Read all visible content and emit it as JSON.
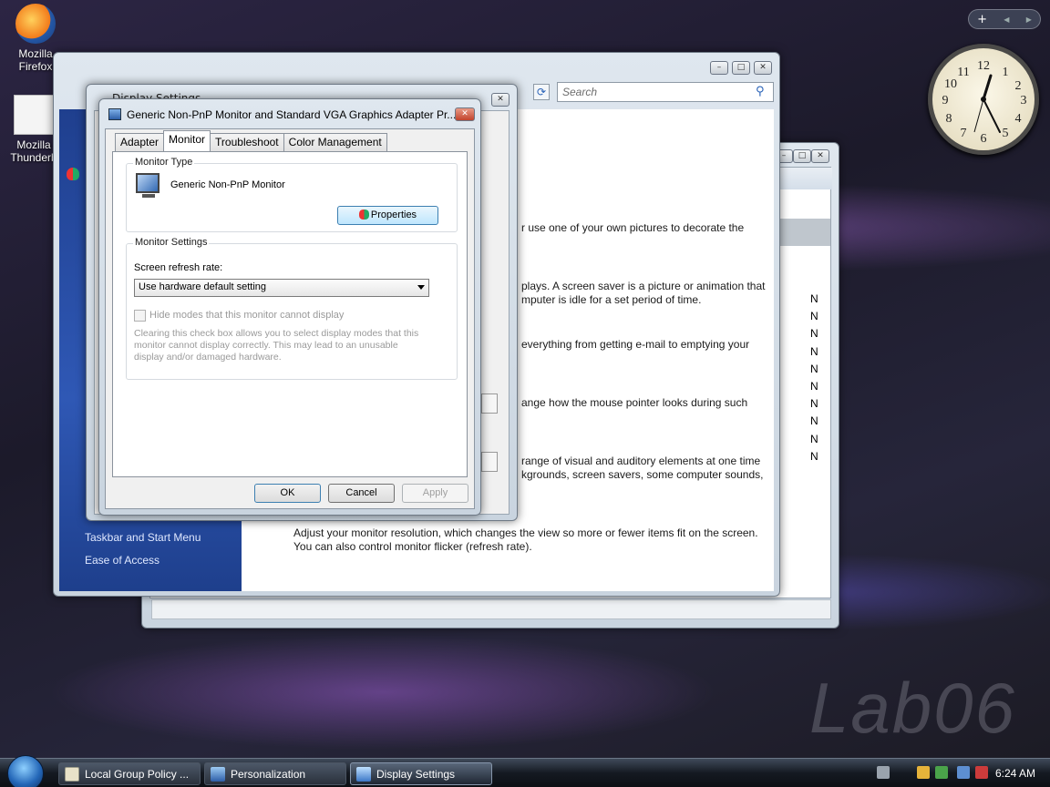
{
  "desktop": {
    "icons": [
      {
        "label_line1": "Mozilla",
        "label_line2": "Firefox"
      },
      {
        "label_line1": "Mozilla",
        "label_line2": "Thunderb"
      }
    ],
    "watermark": "Lab06"
  },
  "gadgets": {
    "toolbar_add": "+",
    "toolbar_prev": "◀",
    "toolbar_next": "▶",
    "clock_numbers": [
      "12",
      "1",
      "2",
      "3",
      "4",
      "5",
      "6",
      "7",
      "8",
      "9",
      "10",
      "11"
    ]
  },
  "personalization": {
    "title_partial": "Display Settings",
    "search_placeholder": "Search",
    "left_links": [
      "Taskbar and Start Menu",
      "Ease of Access"
    ],
    "main_lines": [
      "r use one of your own pictures to decorate the",
      "plays. A screen saver is a picture or animation that",
      "mputer is idle for a set period of time.",
      "everything from getting e-mail to emptying your",
      "ange how the mouse pointer looks during such",
      "range of visual and auditory elements at one time",
      "kgrounds, screen savers, some computer sounds,",
      "Adjust your monitor resolution, which changes the view so more or fewer items fit on the screen.",
      "You can also control monitor flicker (refresh rate)."
    ]
  },
  "group_policy": {
    "column_letters": [
      "N",
      "N",
      "N",
      "N",
      "N",
      "N",
      "N",
      "N",
      "N",
      "N"
    ]
  },
  "dialog": {
    "title": "Generic Non-PnP Monitor and Standard VGA Graphics Adapter Pr...",
    "tabs": [
      "Adapter",
      "Monitor",
      "Troubleshoot",
      "Color Management"
    ],
    "active_tab": "Monitor",
    "monitor_type": {
      "group_label": "Monitor Type",
      "monitor_name": "Generic Non-PnP Monitor",
      "properties_button": "Properties"
    },
    "monitor_settings": {
      "group_label": "Monitor Settings",
      "refresh_label": "Screen refresh rate:",
      "refresh_value": "Use hardware default setting",
      "hide_modes_label": "Hide modes that this monitor cannot display",
      "hide_modes_checked": false,
      "hide_modes_enabled": false,
      "help_line1": "Clearing this check box allows you to select display modes that this",
      "help_line2": "monitor cannot display correctly. This may lead to an unusable",
      "help_line3": "display and/or damaged hardware."
    },
    "buttons": {
      "ok": "OK",
      "cancel": "Cancel",
      "apply": "Apply"
    },
    "close_glyph": "✕"
  },
  "taskbar": {
    "buttons": [
      {
        "label": "Local Group Policy ..."
      },
      {
        "label": "Personalization"
      },
      {
        "label": "Display Settings"
      }
    ],
    "clock": "6:24 AM"
  },
  "colors": {
    "accent": "#2f58b5",
    "dialog_close": "#c2432b"
  }
}
